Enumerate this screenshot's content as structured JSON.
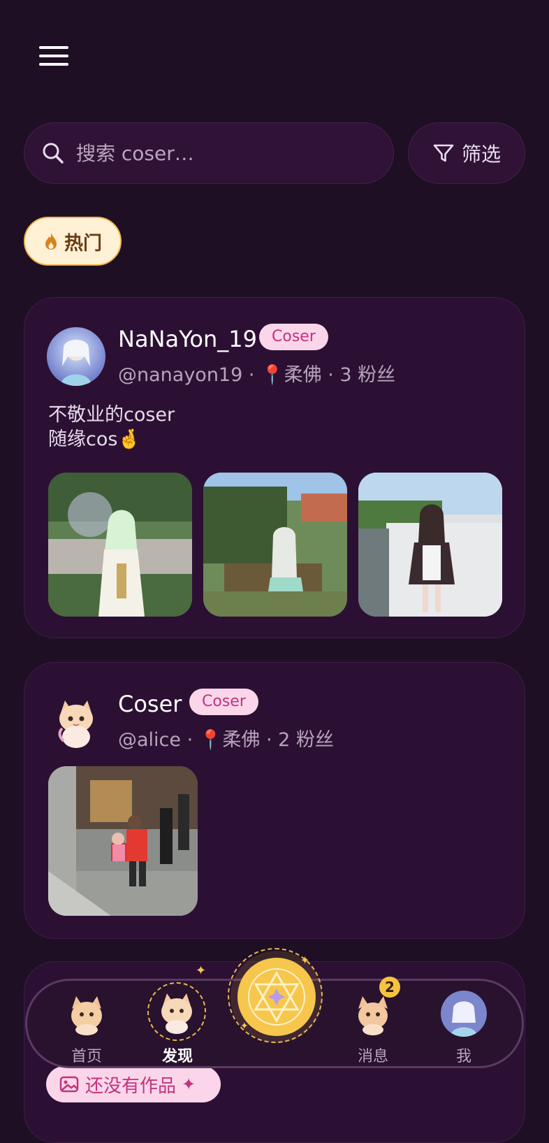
{
  "header": {
    "menu_icon": "hamburger-menu-icon"
  },
  "search": {
    "placeholder": "搜索 coser…",
    "filter_label": "筛选"
  },
  "tabs": {
    "hot_label": "热门"
  },
  "colors": {
    "background": "#1e0f24",
    "card": "#2c1033",
    "accent_gold": "#f6c64d",
    "badge_pink": "#fbd6ea",
    "badge_text": "#c2337a"
  },
  "posts": [
    {
      "name": "NaNaYon_19",
      "badge": "Coser",
      "handle": "@nanayon19",
      "location": "柔佛",
      "followers": "3 粉丝",
      "bio_line1": "不敬业的coser",
      "bio_line2": "随缘cos🤞"
    },
    {
      "name": "Coser",
      "badge": "Coser",
      "handle": "@alice",
      "location": "柔佛",
      "followers": "2 粉丝"
    },
    {
      "empty_label": "还没有作品"
    }
  ],
  "bottom_nav": {
    "home": "首页",
    "discover": "发现",
    "messages": "消息",
    "messages_badge": "2",
    "me": "我"
  }
}
